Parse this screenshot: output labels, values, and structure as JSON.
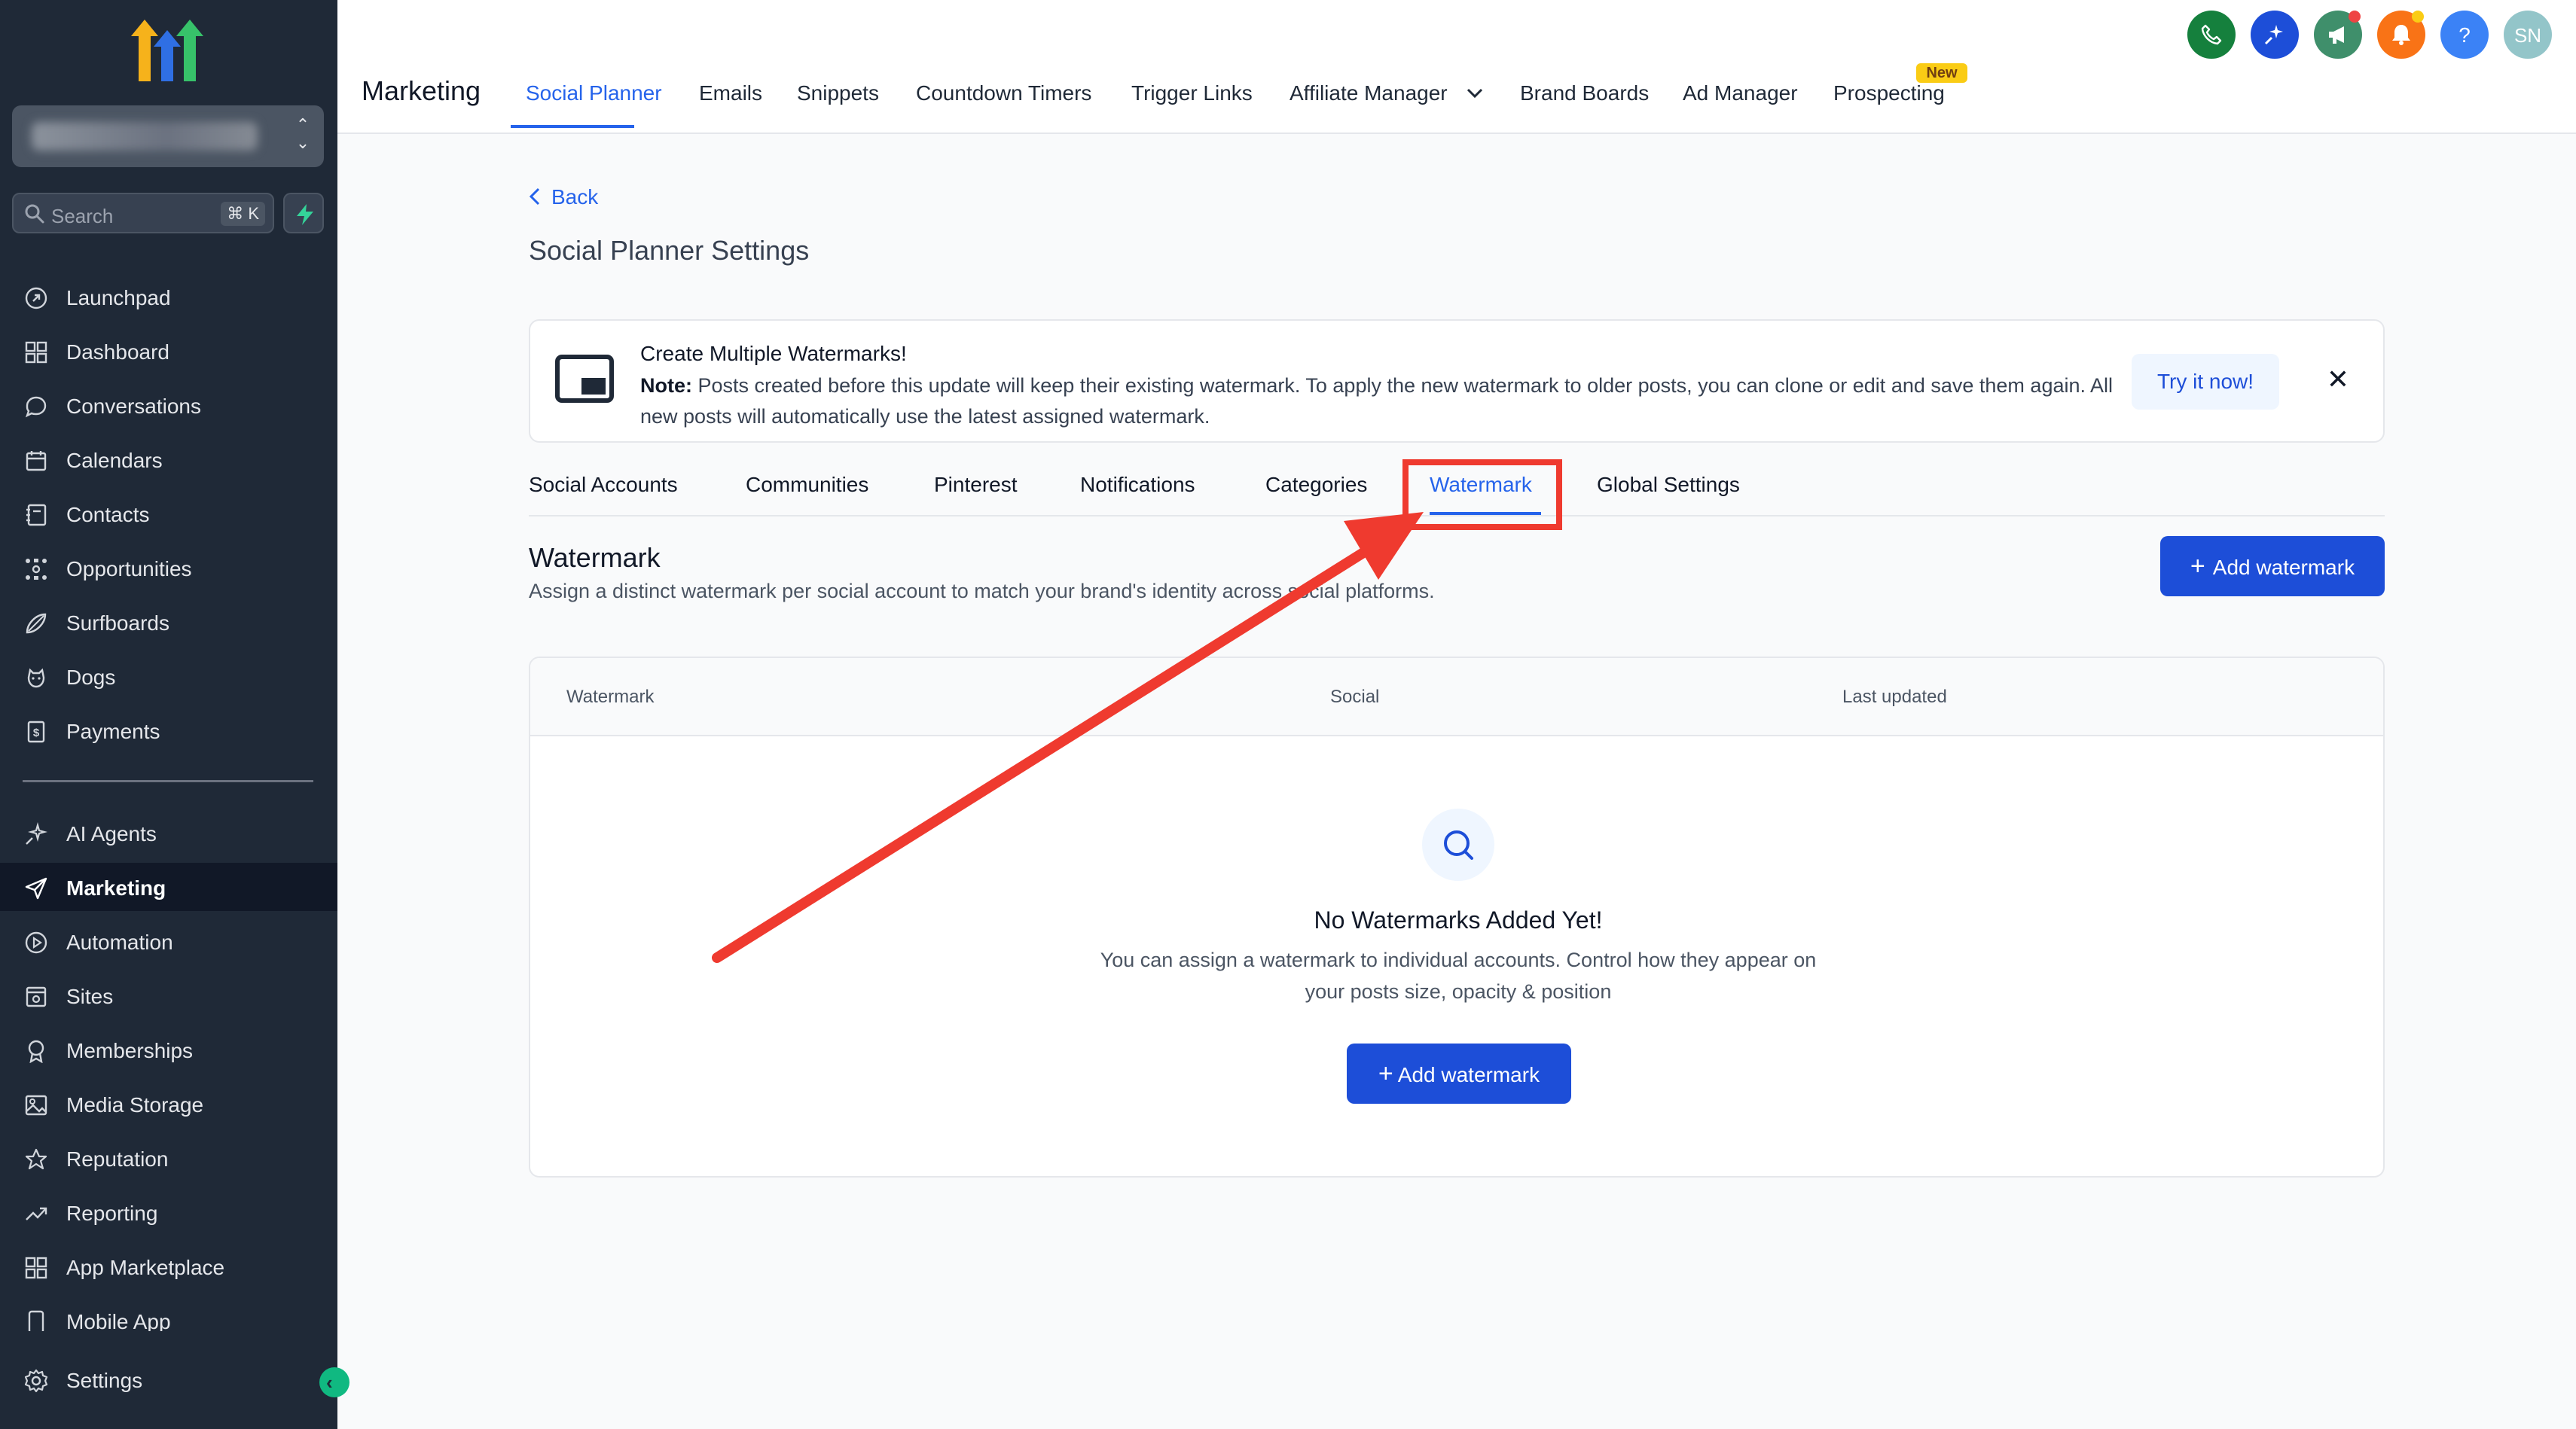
{
  "sidebar": {
    "search": {
      "label": "Search",
      "shortcut": "⌘ K"
    },
    "items": [
      {
        "label": "Launchpad",
        "icon": "rocket-icon"
      },
      {
        "label": "Dashboard",
        "icon": "grid-icon"
      },
      {
        "label": "Conversations",
        "icon": "chat-bubble-icon"
      },
      {
        "label": "Calendars",
        "icon": "calendar-icon"
      },
      {
        "label": "Contacts",
        "icon": "contacts-icon"
      },
      {
        "label": "Opportunities",
        "icon": "network-icon"
      },
      {
        "label": "Surfboards",
        "icon": "surfboard-icon"
      },
      {
        "label": "Dogs",
        "icon": "paw-icon"
      },
      {
        "label": "Payments",
        "icon": "receipt-icon"
      },
      {
        "label": "AI Agents",
        "icon": "sparkles-icon"
      },
      {
        "label": "Marketing",
        "icon": "send-icon",
        "active": true
      },
      {
        "label": "Automation",
        "icon": "automation-icon"
      },
      {
        "label": "Sites",
        "icon": "sites-icon"
      },
      {
        "label": "Memberships",
        "icon": "award-icon"
      },
      {
        "label": "Media Storage",
        "icon": "image-icon"
      },
      {
        "label": "Reputation",
        "icon": "star-icon"
      },
      {
        "label": "Reporting",
        "icon": "trending-icon"
      },
      {
        "label": "App Marketplace",
        "icon": "apps-icon"
      },
      {
        "label": "Mobile App",
        "icon": "mobile-icon"
      }
    ],
    "settings_label": "Settings"
  },
  "header": {
    "title": "Marketing",
    "tabs": [
      {
        "label": "Social Planner",
        "active": true
      },
      {
        "label": "Emails"
      },
      {
        "label": "Snippets"
      },
      {
        "label": "Countdown Timers"
      },
      {
        "label": "Trigger Links"
      },
      {
        "label": "Affiliate Manager"
      },
      {
        "label": "Brand Boards"
      },
      {
        "label": "Ad Manager"
      },
      {
        "label": "Prospecting",
        "badge": "New"
      }
    ],
    "avatar_initials": "SN"
  },
  "main": {
    "back_label": "Back",
    "page_title": "Social Planner Settings",
    "banner": {
      "title": "Create Multiple Watermarks!",
      "note_label": "Note:",
      "note_text": " Posts created before this update will keep their existing watermark. To apply the new watermark to older posts, you can clone or edit and save them again. All new posts will automatically use the latest assigned watermark.",
      "cta": "Try it now!"
    },
    "settings_tabs": [
      {
        "label": "Social Accounts"
      },
      {
        "label": "Communities"
      },
      {
        "label": "Pinterest"
      },
      {
        "label": "Notifications"
      },
      {
        "label": "Categories"
      },
      {
        "label": "Watermark",
        "active": true
      },
      {
        "label": "Global Settings"
      }
    ],
    "section": {
      "title": "Watermark",
      "description": "Assign a distinct watermark per social account to match your brand's identity across social platforms.",
      "add_button": "Add watermark"
    },
    "table": {
      "columns": [
        "Watermark",
        "Social",
        "Last updated"
      ],
      "empty_title": "No Watermarks Added Yet!",
      "empty_description": "You can assign a watermark to individual accounts. Control how they appear on your posts size, opacity & position",
      "empty_button": "Add watermark"
    }
  },
  "colors": {
    "sidebar_bg": "#1f2937",
    "accent": "#1d4ed8",
    "annotation_red": "#ef3a2f"
  }
}
